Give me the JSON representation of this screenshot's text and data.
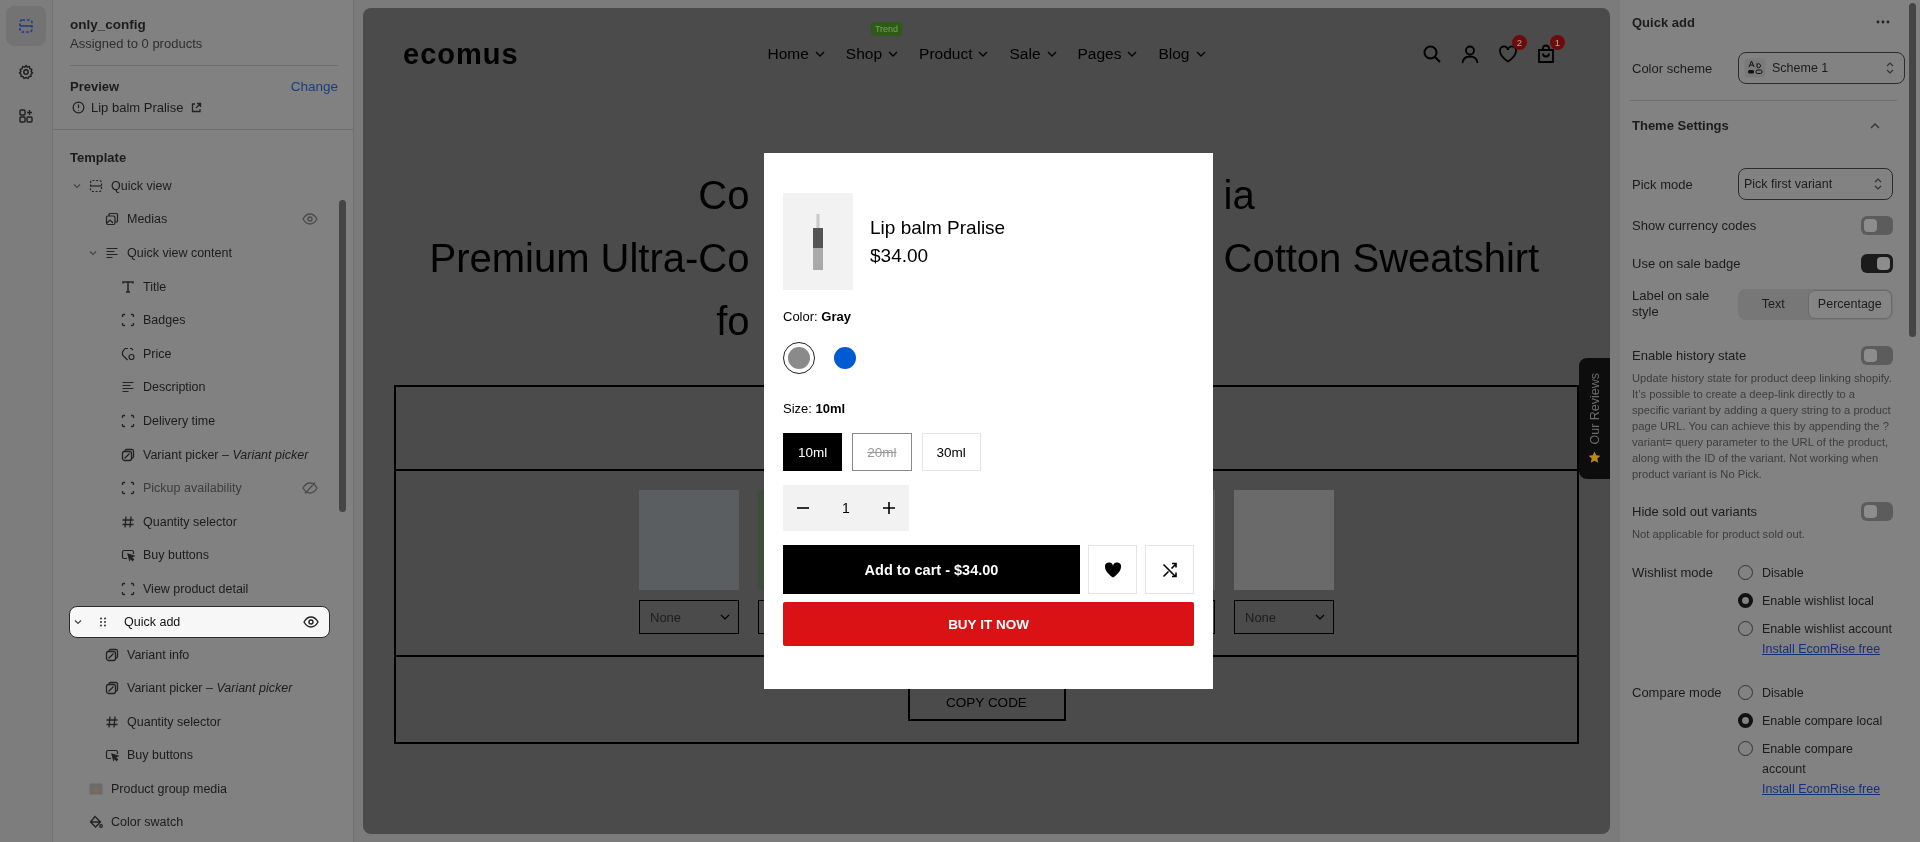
{
  "rail": [
    {
      "kind": "sections",
      "selected": true
    },
    {
      "kind": "settings",
      "selected": false
    },
    {
      "kind": "apps",
      "selected": false
    }
  ],
  "sidebar": {
    "title": "only_config",
    "subtitle": "Assigned to 0 products",
    "preview_label": "Preview",
    "change_link": "Change",
    "preview_product": "Lip balm Pralise",
    "template_label": "Template",
    "tree": [
      {
        "label": "Quick view",
        "kind": "section",
        "selected": false,
        "expanded": true,
        "children": [
          {
            "label": "Medias",
            "kind": "media",
            "selected": false,
            "visible": true
          },
          {
            "label": "Quick view content",
            "kind": "text",
            "selected": false,
            "expanded": true,
            "children": [
              {
                "label": "Title",
                "kind": "title",
                "selected": false
              },
              {
                "label": "Badges",
                "kind": "block",
                "selected": false
              },
              {
                "label": "Price",
                "kind": "price",
                "selected": false
              },
              {
                "label": "Description",
                "kind": "text",
                "selected": false
              },
              {
                "label": "Delivery time",
                "kind": "block",
                "selected": false
              },
              {
                "label": "Variant picker – *Variant picker*",
                "kind": "variant",
                "selected": false
              },
              {
                "label": "Pickup availability",
                "kind": "block",
                "selected": false,
                "visible": false
              },
              {
                "label": "Quantity selector",
                "kind": "quantity",
                "selected": false
              },
              {
                "label": "Buy buttons",
                "kind": "buttons",
                "selected": false
              },
              {
                "label": "View product detail",
                "kind": "block",
                "selected": false
              }
            ]
          }
        ]
      },
      {
        "label": "Quick add",
        "kind": "section",
        "selected": true,
        "expanded": true,
        "visible": true,
        "children": [
          {
            "label": "Variant info",
            "kind": "variant",
            "selected": false
          },
          {
            "label": "Variant picker – *Variant picker*",
            "kind": "variant",
            "selected": false
          },
          {
            "label": "Quantity selector",
            "kind": "quantity",
            "selected": false
          },
          {
            "label": "Buy buttons",
            "kind": "buttons",
            "selected": false
          }
        ]
      },
      {
        "label": "Product group media",
        "kind": "image",
        "selected": false
      },
      {
        "label": "Color swatch",
        "kind": "swatch",
        "selected": false
      }
    ]
  },
  "store": {
    "logo": "ecomus",
    "nav": [
      {
        "label": "Home"
      },
      {
        "label": "Shop",
        "badge": "Trend"
      },
      {
        "label": "Product"
      },
      {
        "label": "Sale"
      },
      {
        "label": "Pages"
      },
      {
        "label": "Blog"
      }
    ],
    "wishlist_count": "2",
    "cart_count": "1",
    "heading_lines": [
      {
        "left": "Co",
        "right": "ia"
      },
      {
        "left": "Premium Ultra-Co",
        "right": "Cotton Sweatshirt"
      },
      {
        "left": "fo"
      }
    ],
    "product_columns": [
      {
        "option": "None"
      },
      {},
      {},
      {},
      {},
      {
        "option": "None"
      }
    ],
    "copy_button": "COPY CODE",
    "reviews_tab": "Our Reviews"
  },
  "modal": {
    "product_title": "Lip balm Pralise",
    "price": "$34.00",
    "color_label": "Color:",
    "color_value": "Gray",
    "swatches": [
      {
        "color": "#8a8a8a",
        "selected": true
      },
      {
        "color": "#005bd3",
        "selected": false
      }
    ],
    "size_label": "Size:",
    "size_value": "10ml",
    "sizes": [
      {
        "label": "10ml",
        "selected": true,
        "available": true
      },
      {
        "label": "20ml",
        "selected": false,
        "available": false
      },
      {
        "label": "30ml",
        "selected": false,
        "available": true
      }
    ],
    "quantity": "1",
    "add_to_cart": "Add to cart - $34.00",
    "buy_now": "BUY IT NOW"
  },
  "settings": {
    "title": "Quick add",
    "scheme_label": "Color scheme",
    "scheme_value": "Scheme 1",
    "group_title": "Theme Settings",
    "group_expanded": true,
    "fields": [
      {
        "kind": "select",
        "label": "Pick mode",
        "value": "Pick first variant"
      },
      {
        "kind": "toggle",
        "label": "Show currency codes",
        "on": false
      },
      {
        "kind": "toggle",
        "label": "Use on sale badge",
        "on": true
      },
      {
        "kind": "segmented",
        "label": "Label on sale style",
        "options": [
          {
            "label": "Text",
            "selected": false
          },
          {
            "label": "Percentage",
            "selected": true
          }
        ]
      },
      {
        "kind": "toggle",
        "label": "Enable history state",
        "on": false,
        "help": "Update history state for product deep linking shopify. It’s possible to create a deep-link directly to a specific variant by adding a query string to a product page URL. You can achieve this by appending the ?variant= query parameter to the URL of the product, along with the ID of the variant. Not working when product variant is No Pick."
      },
      {
        "kind": "toggle",
        "label": "Hide sold out variants",
        "on": false,
        "help": "Not applicable for product sold out."
      },
      {
        "kind": "radio",
        "label": "Wishlist mode",
        "options": [
          {
            "label": "Disable",
            "selected": false
          },
          {
            "label": "Enable wishlist local",
            "selected": true
          },
          {
            "label": "Enable wishlist account",
            "selected": false,
            "link": "Install EcomRise free"
          }
        ]
      },
      {
        "kind": "radio",
        "label": "Compare mode",
        "options": [
          {
            "label": "Disable",
            "selected": false
          },
          {
            "label": "Enable compare local",
            "selected": true
          },
          {
            "label": "Enable compare account",
            "selected": false,
            "link": "Install EcomRise free"
          }
        ]
      }
    ]
  }
}
